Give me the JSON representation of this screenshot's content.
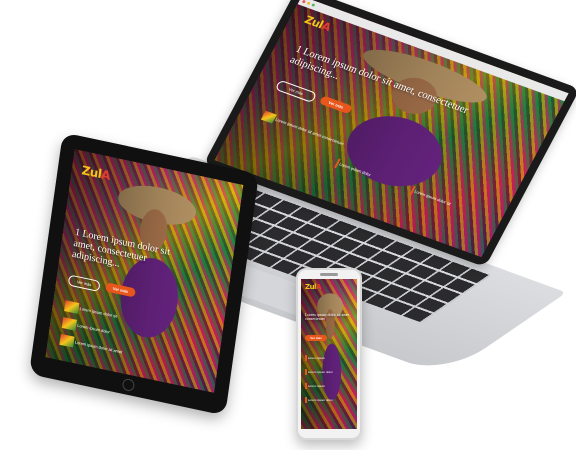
{
  "brand": {
    "logo_z": "Z",
    "logo_mid": "ul",
    "logo_a": "A",
    "accent": "#e8561c",
    "logo_color": "#f5c51a"
  },
  "laptop": {
    "hero_text": "1 Lorem ipsum dolor sit amet, consectetuer adipiscing...",
    "cta_label": "Ver más",
    "outline_label": "Ver más",
    "cards": [
      "Lorem ipsum dolor sit amet consectetuer",
      "Lorem ipsum dolor",
      "Lorem ipsum dolor sit"
    ]
  },
  "tablet": {
    "hero_text": "1 Lorem ipsum dolor sit amet, consectetuer adipiscing...",
    "cta_label": "Ver más",
    "outline_label": "Ver más",
    "cards": [
      "Lorem ipsum dolor sit",
      "Lorem ipsum dolor",
      "Lorem ipsum dolor sit amet"
    ]
  },
  "phone": {
    "hero_text": "Lorem ipsum dolor sit amet, consectetuer",
    "cta_label": "Ver más",
    "cards": [
      "Lorem ipsum",
      "Lorem ipsum dolor",
      "Lorem ipsum",
      "Lorem ipsum dolor"
    ]
  }
}
